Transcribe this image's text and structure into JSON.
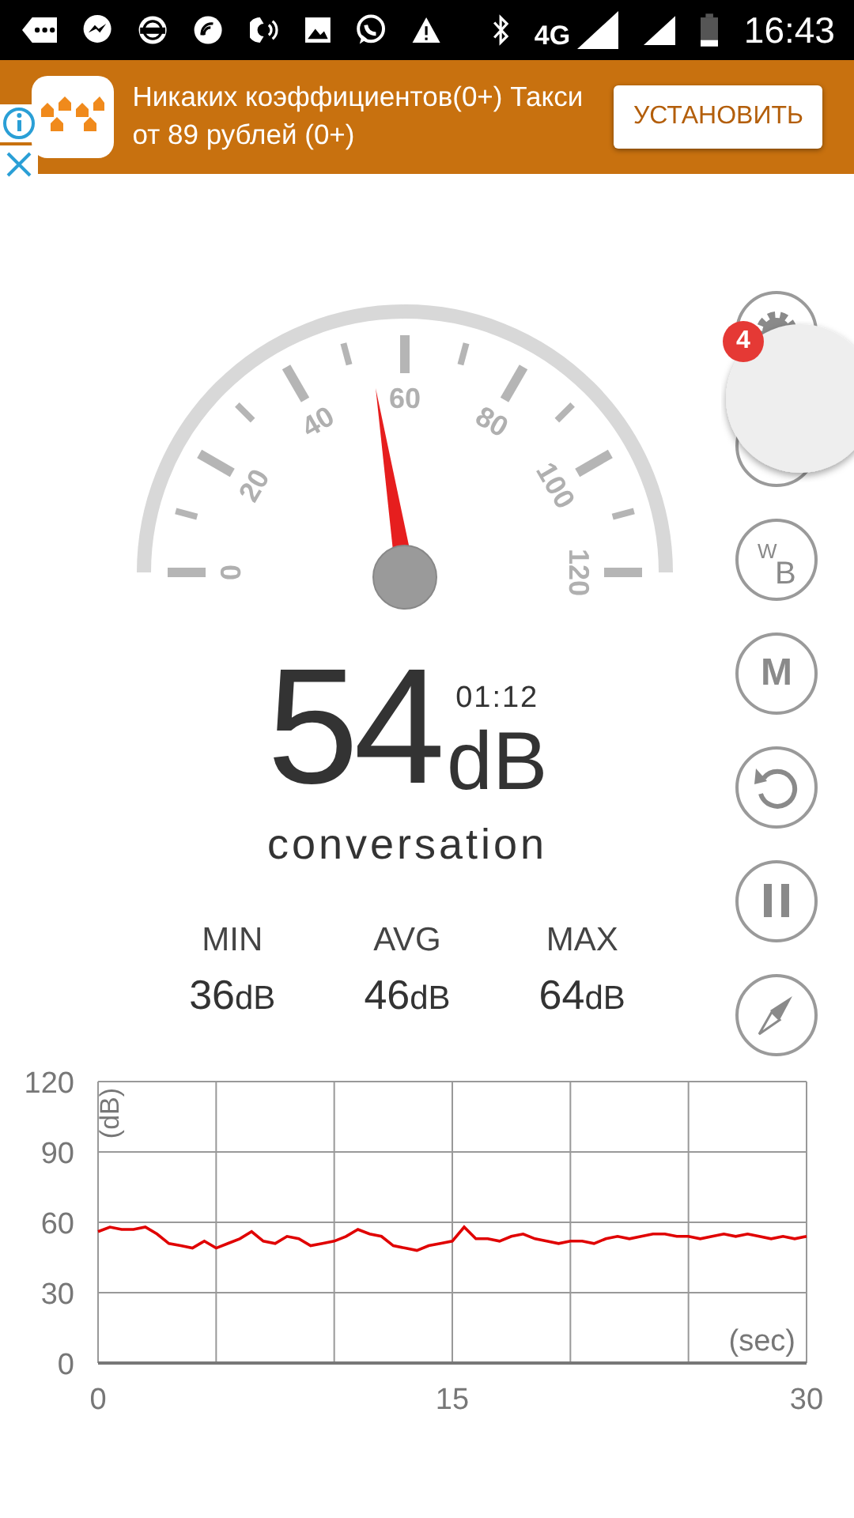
{
  "status_bar": {
    "network": "4G",
    "time": "16:43"
  },
  "ad": {
    "title": "Никаких коэффициентов(0+) Такси от 89 рублей (0+)",
    "button": "УСТАНОВИТЬ"
  },
  "gauge": {
    "scale_labels": [
      "0",
      "20",
      "40",
      "60",
      "80",
      "100",
      "120"
    ]
  },
  "reading": {
    "value": "54",
    "unit": "dB",
    "timer": "01:12",
    "description": "conversation"
  },
  "stats": [
    {
      "label": "MIN",
      "value": "36",
      "unit": "dB"
    },
    {
      "label": "AVG",
      "value": "46",
      "unit": "dB"
    },
    {
      "label": "MAX",
      "value": "64",
      "unit": "dB"
    }
  ],
  "side_buttons": [
    {
      "kind": "settings"
    },
    {
      "kind": "covered"
    },
    {
      "kind": "weighting",
      "labels": [
        "W",
        "B"
      ]
    },
    {
      "kind": "text",
      "labels": [
        "M"
      ]
    },
    {
      "kind": "reset"
    },
    {
      "kind": "pause"
    },
    {
      "kind": "compass"
    }
  ],
  "floating_bubble": {
    "badge": "4"
  },
  "chart": {
    "chart_data": {
      "type": "line",
      "xlabel": "(sec)",
      "ylabel": "(dB)",
      "xlim": [
        0,
        30
      ],
      "ylim": [
        0,
        120
      ],
      "xticks": [
        0,
        15,
        30
      ],
      "grid": true,
      "yticks": [
        0,
        30,
        60,
        90,
        120
      ],
      "x": [
        0,
        0.5,
        1,
        1.5,
        2,
        2.5,
        3,
        3.5,
        4,
        4.5,
        5,
        5.5,
        6,
        6.5,
        7,
        7.5,
        8,
        8.5,
        9,
        9.5,
        10,
        10.5,
        11,
        11.5,
        12,
        12.5,
        13,
        13.5,
        14,
        14.5,
        15,
        15.5,
        16,
        16.5,
        17,
        17.5,
        18,
        18.5,
        19,
        19.5,
        20,
        20.5,
        21,
        21.5,
        22,
        22.5,
        23,
        23.5,
        24,
        24.5,
        25,
        25.5,
        26,
        26.5,
        27,
        27.5,
        28,
        28.5,
        29,
        29.5,
        30
      ],
      "series": [
        {
          "color": "#e00000",
          "values": [
            56,
            58,
            57,
            57,
            58,
            55,
            51,
            50,
            49,
            52,
            49,
            51,
            53,
            56,
            52,
            51,
            54,
            53,
            50,
            51,
            52,
            54,
            57,
            55,
            54,
            50,
            49,
            48,
            50,
            51,
            52,
            58,
            53,
            53,
            52,
            54,
            55,
            53,
            52,
            51,
            52,
            52,
            51,
            53,
            54,
            53,
            54,
            55,
            55,
            54,
            54,
            53,
            54,
            55,
            54,
            55,
            54,
            53,
            54,
            53,
            54
          ]
        }
      ]
    }
  }
}
